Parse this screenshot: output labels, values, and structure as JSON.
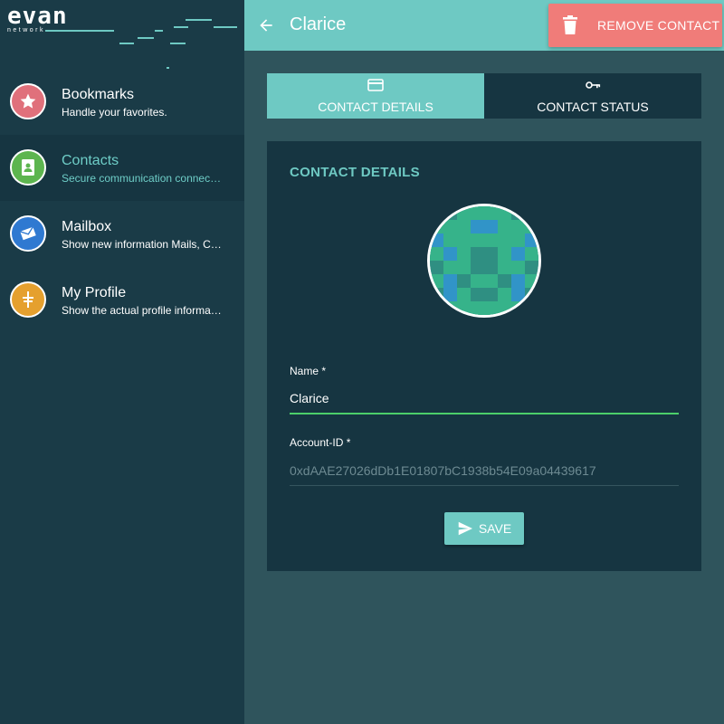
{
  "brand": {
    "name": "evan",
    "tagline": "network"
  },
  "sidebar": {
    "items": [
      {
        "title": "Bookmarks",
        "subtitle": "Handle your favorites.",
        "icon": "star-icon",
        "color": "#e0707b"
      },
      {
        "title": "Contacts",
        "subtitle": "Secure communication connections",
        "icon": "address-book-icon",
        "color": "#5db54f",
        "active": true
      },
      {
        "title": "Mailbox",
        "subtitle": "Show new information Mails, Contact requests",
        "icon": "mail-icon",
        "color": "#2f79d1"
      },
      {
        "title": "My Profile",
        "subtitle": "Show the actual profile information",
        "icon": "profile-icon",
        "color": "#e5a02e"
      }
    ]
  },
  "header": {
    "title": "Clarice",
    "remove_label": "REMOVE CONTACT"
  },
  "tabs": [
    {
      "label": "CONTACT DETAILS",
      "icon": "card-icon",
      "active": true
    },
    {
      "label": "CONTACT STATUS",
      "icon": "key-icon",
      "active": false
    }
  ],
  "card": {
    "title": "CONTACT DETAILS",
    "name_label": "Name *",
    "name_value": "Clarice",
    "account_label": "Account-ID *",
    "account_value": "0xdAAE27026dDb1E01807bC1938b54E09a04439617",
    "save_label": "SAVE"
  },
  "colors": {
    "accent": "#6ec9c3",
    "sidebar": "#1a3b47",
    "danger": "#f07c79",
    "input_focus": "#4ccf6a"
  }
}
